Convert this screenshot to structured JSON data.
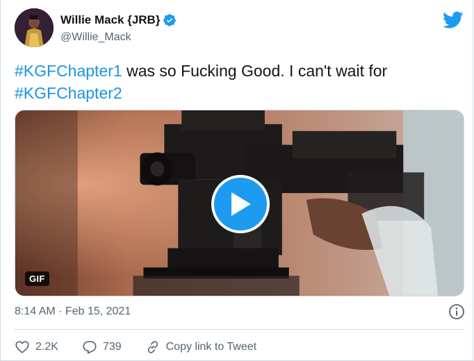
{
  "author": {
    "name": "Willie Mack {JRB}",
    "handle": "@Willie_Mack",
    "verified": true
  },
  "tweet": {
    "hashtag1": "#KGFChapter1",
    "text_middle": " was so Fucking Good. I can't wait for ",
    "hashtag2": "#KGFChapter2"
  },
  "media": {
    "badge": "GIF",
    "play_icon": "play-icon"
  },
  "meta": {
    "timestamp": "8:14 AM · Feb 15, 2021",
    "info_icon": "info-icon"
  },
  "actions": {
    "likes": "2.2K",
    "replies": "739",
    "copy_link": "Copy link to Tweet"
  },
  "colors": {
    "accent": "#1d9bf0",
    "hashtag": "#1b95e0",
    "secondary_text": "#536471"
  }
}
